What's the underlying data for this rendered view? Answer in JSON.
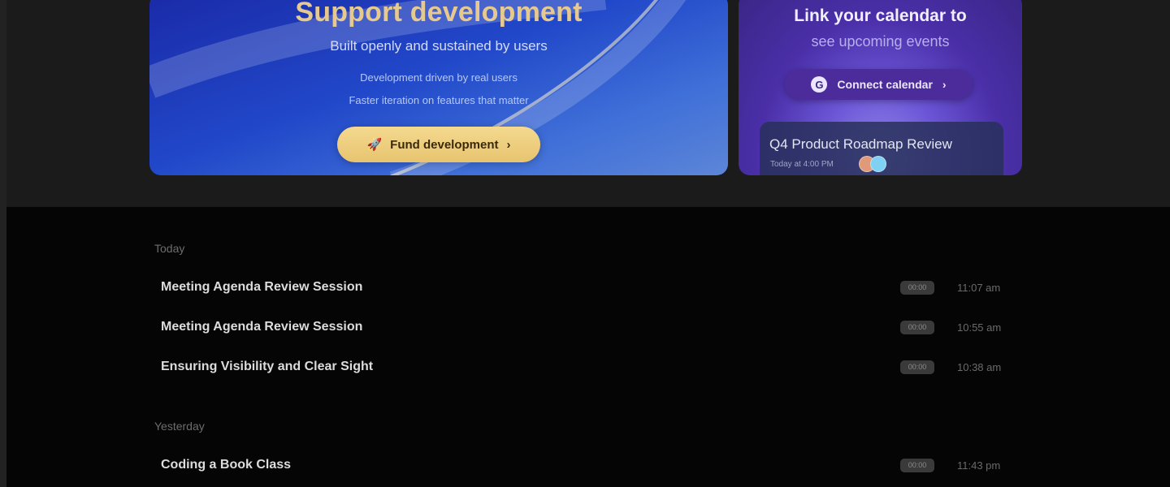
{
  "support_card": {
    "title": "Support development",
    "subtitle": "Built openly and sustained by users",
    "line1": "Development driven by real users",
    "line2": "Faster iteration on features that matter",
    "button_label": "Fund development",
    "button_icon": "rocket-icon"
  },
  "calendar_card": {
    "title": "Link your calendar to",
    "subtitle": "see upcoming events",
    "button_label": "Connect calendar",
    "button_icon": "google-icon",
    "event": {
      "title": "Q4 Product Roadmap Review",
      "time": "Today at 4:00 PM"
    }
  },
  "history": {
    "sections": [
      {
        "label": "Today",
        "items": [
          {
            "title": "Meeting Agenda Review Session",
            "badge": "00:00",
            "time": "11:07 am"
          },
          {
            "title": "Meeting Agenda Review Session",
            "badge": "00:00",
            "time": "10:55 am"
          },
          {
            "title": "Ensuring Visibility and Clear Sight",
            "badge": "00:00",
            "time": "10:38 am"
          }
        ]
      },
      {
        "label": "Yesterday",
        "items": [
          {
            "title": "Coding a Book Class",
            "badge": "00:00",
            "time": "11:43 pm"
          }
        ]
      }
    ]
  }
}
